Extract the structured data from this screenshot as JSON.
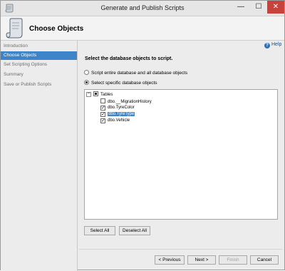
{
  "window": {
    "title": "Generate and Publish Scripts",
    "controls": {
      "minimize": "—",
      "maximize": "☐",
      "close": "✕"
    }
  },
  "header": {
    "title": "Choose Objects"
  },
  "nav": {
    "items": [
      {
        "label": "Introduction",
        "active": false
      },
      {
        "label": "Choose Objects",
        "active": true
      },
      {
        "label": "Set Scripting Options",
        "active": false
      },
      {
        "label": "Summary",
        "active": false
      },
      {
        "label": "Save or Publish Scripts",
        "active": false
      }
    ]
  },
  "help": {
    "label": "Help"
  },
  "main": {
    "instruction": "Select the database objects to script.",
    "options": [
      {
        "label": "Script entire database and all database objects",
        "checked": false
      },
      {
        "label": "Select specific database objects",
        "checked": true
      }
    ],
    "tree": {
      "root": {
        "label": "Tables",
        "expander": "−",
        "state": "indeterminate"
      },
      "children": [
        {
          "label": "dbo.__MigrationHistory",
          "checked": false,
          "selected": false
        },
        {
          "label": "dbo.TyreColor",
          "checked": true,
          "selected": false
        },
        {
          "label": "dbo.TyreType",
          "checked": true,
          "selected": true
        },
        {
          "label": "dbo.Vehicle",
          "checked": true,
          "selected": false
        }
      ]
    },
    "select_all": "Select All",
    "deselect_all": "Deselect All"
  },
  "footer": {
    "previous": "< Previous",
    "next": "Next >",
    "finish": "Finish",
    "cancel": "Cancel"
  },
  "colors": {
    "accent": "#3e84c9",
    "close": "#c7423a"
  }
}
